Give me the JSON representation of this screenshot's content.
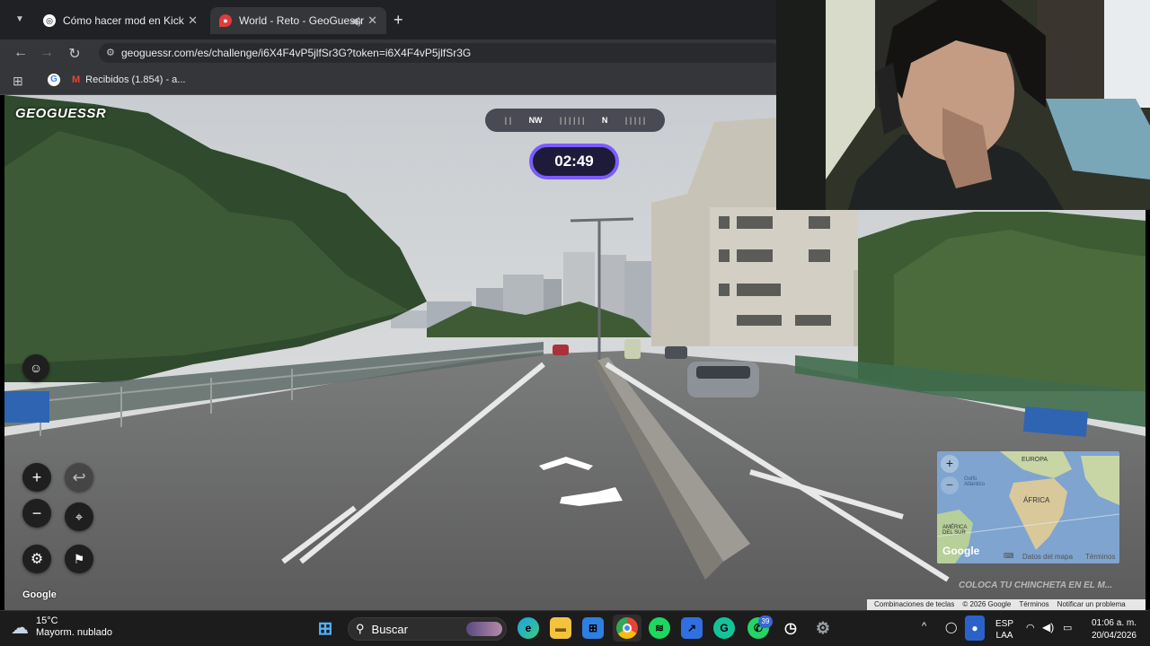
{
  "browser": {
    "tabs": [
      {
        "title": "Cómo hacer mod en Kick",
        "close": "✕"
      },
      {
        "title": "World - Reto - GeoGuessr",
        "close": "✕"
      }
    ],
    "new_tab": "+",
    "url": "geoguessr.com/es/challenge/i6X4F4vP5jlfSr3G?token=i6X4F4vP5jlfSr3G",
    "bookmark": "Recibidos (1.854) - a..."
  },
  "game": {
    "logo": "GEOGUESSR",
    "compass": {
      "nw": "NW",
      "n": "N"
    },
    "timer": "02:49",
    "google": "Google",
    "minimap": {
      "labels": [
        "EUROPA",
        "ÁFRICA",
        "AMÉRICA DEL SUR",
        "Golfo Atlántico"
      ],
      "google": "Google",
      "data": "Datos del mapa",
      "terms": "Términos"
    },
    "place_pin": "COLOCA TU CHINCHETA EN EL M...",
    "footer": {
      "shortcuts": "Combinaciones de teclas",
      "copyright": "© 2026 Google",
      "terms": "Términos",
      "report": "Notificar un problema"
    }
  },
  "taskbar": {
    "weather_temp": "15°C",
    "weather_desc": "Mayorm. nublado",
    "search": "Buscar",
    "lang1": "ESP",
    "lang2": "LAA",
    "time": "01:06 a. m.",
    "date": "20/04/2026",
    "badges": {
      "whatsapp": "39"
    }
  },
  "colors": {
    "accent": "#7b5cff",
    "chrome_bg": "#202124",
    "taskbar_bg": "#1c1c1c",
    "geoguessr_red": "#e23b3b"
  }
}
